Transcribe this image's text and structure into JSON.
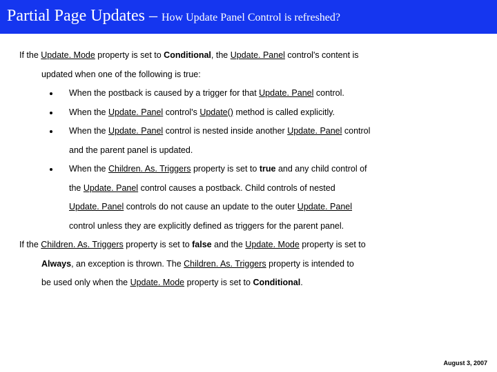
{
  "title": {
    "main": "Partial Page Updates",
    "sep": " – ",
    "sub": "How Update Panel Control is refreshed?"
  },
  "intro": {
    "pre": "If the ",
    "link1": "Update. Mode",
    "mid1": " property is set to ",
    "bold1": "Conditional",
    "mid2": ", the ",
    "link2": "Update. Panel",
    "post": " control's content is"
  },
  "intro_line2": "updated when one of the following is true:",
  "bullets": {
    "b1": {
      "pre": "When the postback is caused by a trigger for that ",
      "link": "Update. Panel",
      "post": " control."
    },
    "b2": {
      "pre": "When the ",
      "link1": "Update. Panel",
      "mid": " control's ",
      "link2": "Update()",
      "post": " method is called explicitly."
    },
    "b3": {
      "pre": "When the ",
      "link1": "Update. Panel",
      "mid": " control is nested inside another ",
      "link2": "Update. Panel",
      "post": " control",
      "line2": "and the parent panel is updated."
    },
    "b4": {
      "pre": "When the ",
      "link1": "Children. As. Triggers",
      "mid1": " property is set to ",
      "bold1": "true",
      "mid2": " and any child control of",
      "l2a": "the ",
      "l2link": "Update. Panel",
      "l2b": " control causes a postback. Child controls of nested",
      "l3link": "Update. Panel",
      "l3a": " controls do not cause an update to the outer ",
      "l3link2": "Update. Panel",
      "l4": "control unless they are explicitly defined as triggers for the parent panel."
    }
  },
  "closing": {
    "l1a": "If the ",
    "l1link1": "Children. As. Triggers",
    "l1b": " property is set to ",
    "l1bold1": "false",
    "l1c": " and the ",
    "l1link2": "Update. Mode",
    "l1d": " property is set to",
    "l2bold": "Always",
    "l2a": ", an exception is thrown. The ",
    "l2link": "Children. As. Triggers",
    "l2b": " property is intended to",
    "l3a": "be used only when the ",
    "l3link": "Update. Mode",
    "l3b": " property is set to ",
    "l3bold": "Conditional",
    "l3c": "."
  },
  "footer_date": "August 3, 2007"
}
